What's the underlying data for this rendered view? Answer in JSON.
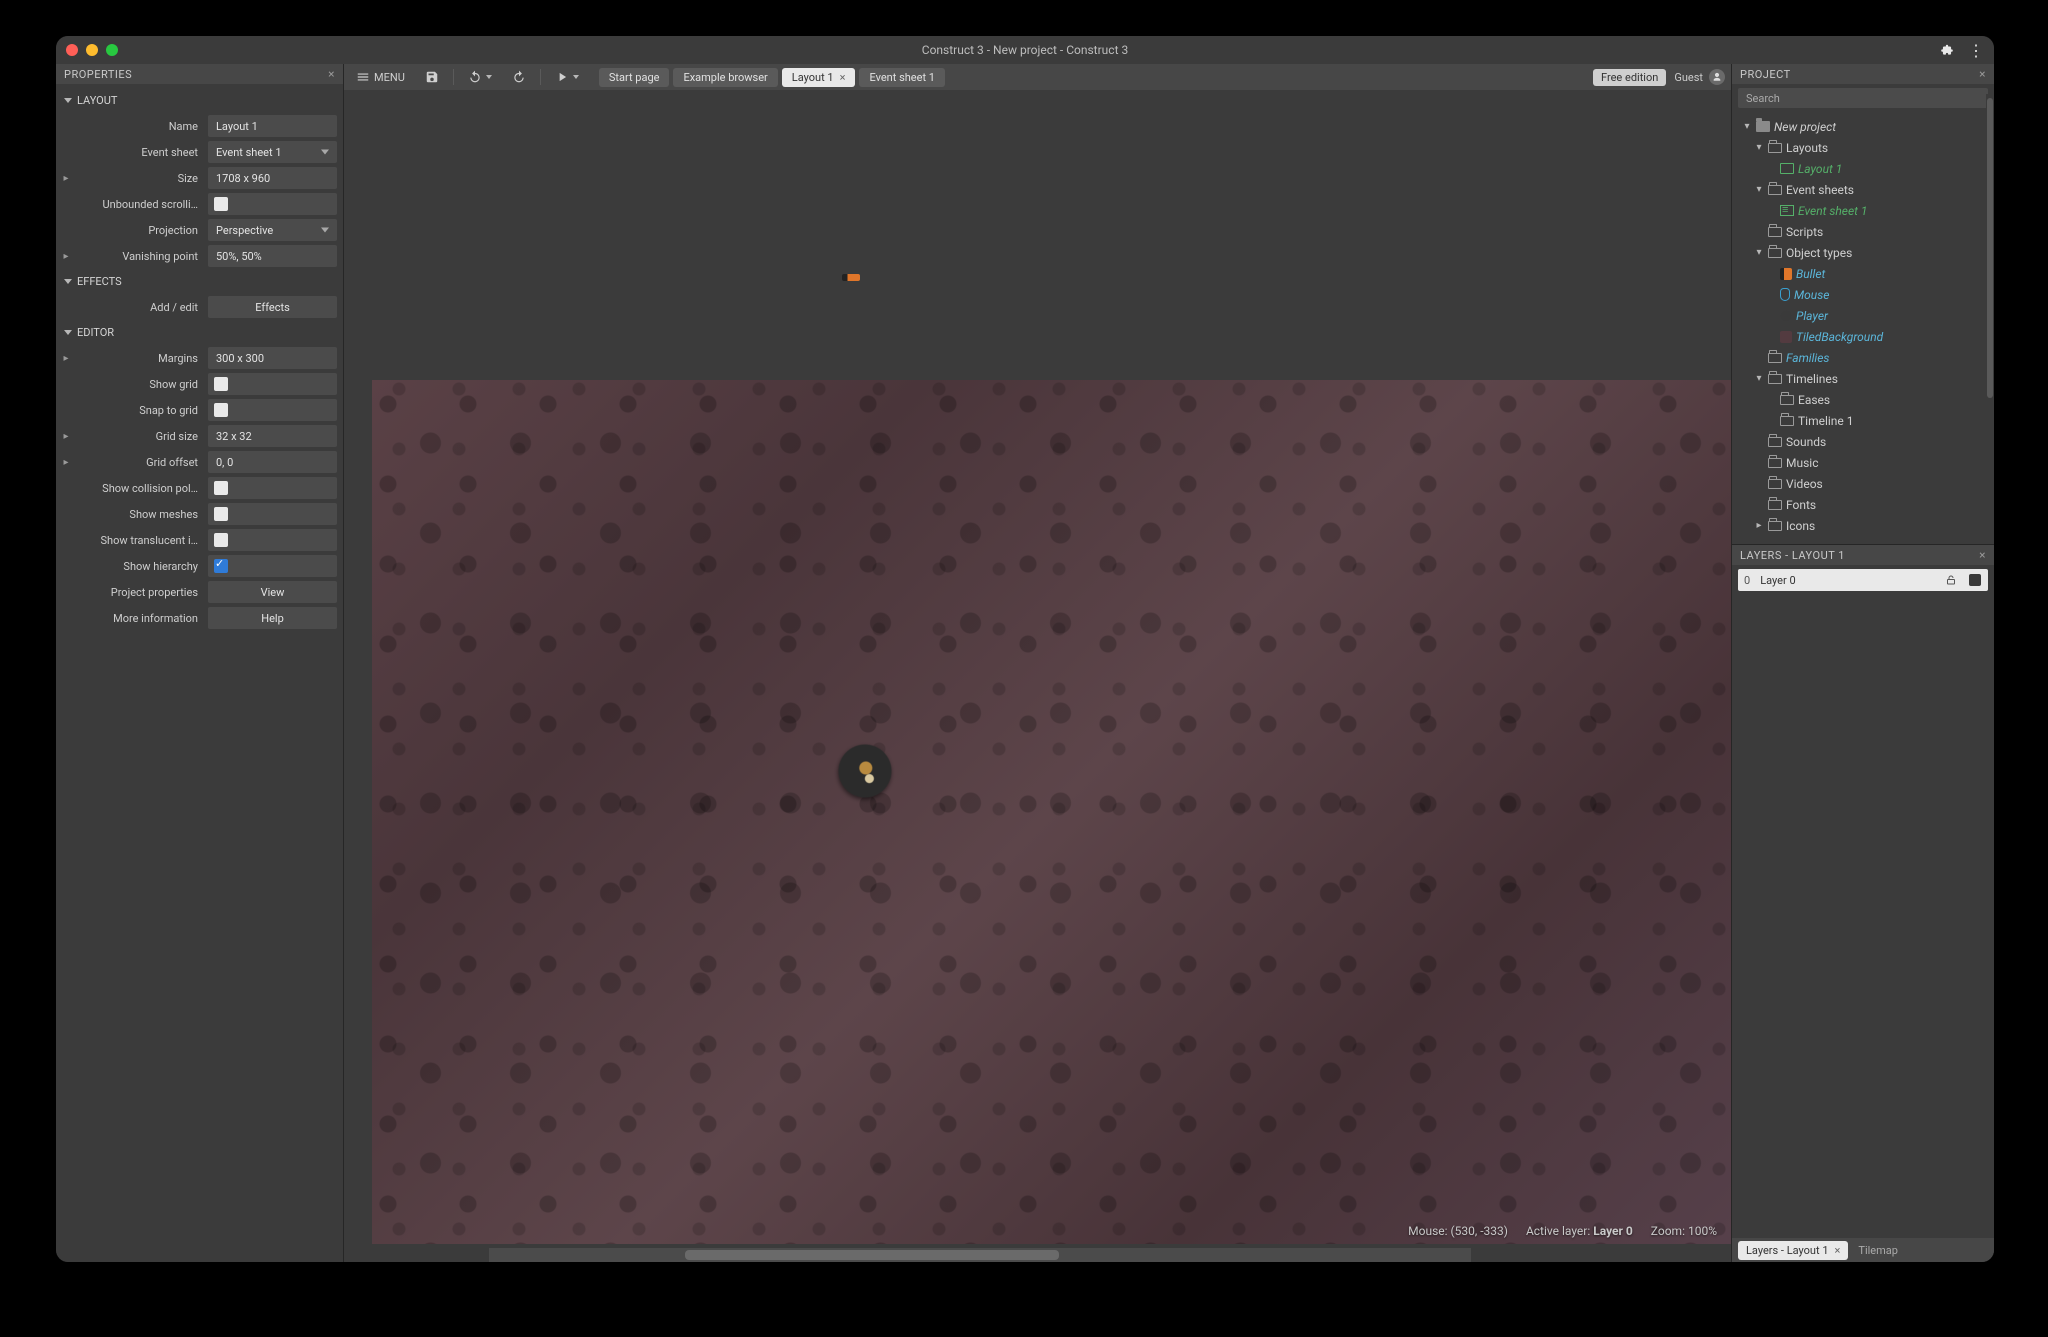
{
  "title": "Construct 3 - New project - Construct 3",
  "menu_label": "MENU",
  "toolbar": {
    "tabs": [
      {
        "label": "Start page",
        "active": false,
        "closable": false
      },
      {
        "label": "Example browser",
        "active": false,
        "closable": false
      },
      {
        "label": "Layout 1",
        "active": true,
        "closable": true
      },
      {
        "label": "Event sheet 1",
        "active": false,
        "closable": false
      }
    ],
    "badge": "Free edition",
    "guest": "Guest"
  },
  "properties": {
    "panel_title": "PROPERTIES",
    "sections": {
      "layout": {
        "title": "LAYOUT",
        "name_label": "Name",
        "name": "Layout 1",
        "event_sheet_label": "Event sheet",
        "event_sheet": "Event sheet 1",
        "size_label": "Size",
        "size": "1708 x 960",
        "unbounded_label": "Unbounded scrolli…",
        "unbounded": false,
        "projection_label": "Projection",
        "projection": "Perspective",
        "vanishing_label": "Vanishing point",
        "vanishing": "50%, 50%"
      },
      "effects": {
        "title": "EFFECTS",
        "addedit_label": "Add / edit",
        "effects_btn": "Effects"
      },
      "editor": {
        "title": "EDITOR",
        "margins_label": "Margins",
        "margins": "300 x 300",
        "show_grid_label": "Show grid",
        "show_grid": false,
        "snap_label": "Snap to grid",
        "snap": false,
        "grid_size_label": "Grid size",
        "grid_size": "32 x 32",
        "grid_offset_label": "Grid offset",
        "grid_offset": "0, 0",
        "collision_label": "Show collision pol…",
        "collision": false,
        "meshes_label": "Show meshes",
        "meshes": false,
        "translucent_label": "Show translucent i…",
        "translucent": false,
        "hierarchy_label": "Show hierarchy",
        "hierarchy": true,
        "proj_props_label": "Project properties",
        "view_btn": "View",
        "more_info_label": "More information",
        "help_btn": "Help"
      }
    }
  },
  "status": {
    "mouse_label": "Mouse:",
    "mouse": "(530, -333)",
    "layer_label": "Active layer:",
    "layer": "Layer 0",
    "zoom_label": "Zoom:",
    "zoom": "100%"
  },
  "project": {
    "panel_title": "PROJECT",
    "search_placeholder": "Search",
    "root": "New project",
    "layouts_folder": "Layouts",
    "layout1": "Layout 1",
    "event_sheets_folder": "Event sheets",
    "event_sheet1": "Event sheet 1",
    "scripts": "Scripts",
    "object_types": "Object types",
    "obj_bullet": "Bullet",
    "obj_mouse": "Mouse",
    "obj_player": "Player",
    "obj_tiled": "TiledBackground",
    "families": "Families",
    "timelines": "Timelines",
    "eases": "Eases",
    "timeline1": "Timeline 1",
    "sounds": "Sounds",
    "music": "Music",
    "videos": "Videos",
    "fonts": "Fonts",
    "icons": "Icons"
  },
  "layers": {
    "panel_title": "LAYERS - LAYOUT 1",
    "layer0_num": "0",
    "layer0_name": "Layer 0"
  },
  "bottom_tabs": {
    "layers": "Layers - Layout 1",
    "tilemap": "Tilemap"
  }
}
